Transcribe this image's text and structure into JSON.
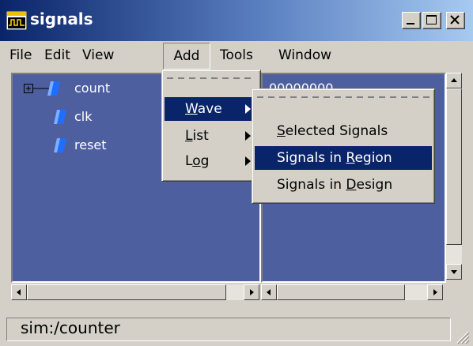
{
  "window": {
    "title": "signals",
    "icon": "wave-window-icon",
    "controls": [
      "minimize-icon",
      "maximize-icon",
      "close-icon"
    ]
  },
  "menubar": {
    "items": [
      {
        "label": "File"
      },
      {
        "label": "Edit"
      },
      {
        "label": "View"
      },
      {
        "label": "Add",
        "open": true
      },
      {
        "label": "Tools"
      },
      {
        "label": "Window"
      }
    ]
  },
  "signals": [
    {
      "name": "count",
      "expandable": true
    },
    {
      "name": "clk",
      "expandable": false
    },
    {
      "name": "reset",
      "expandable": false
    }
  ],
  "values": {
    "first_value": "00000000"
  },
  "add_menu": {
    "items": [
      {
        "pre": "",
        "u": "W",
        "post": "ave",
        "has_submenu": true,
        "highlighted": true
      },
      {
        "pre": "",
        "u": "L",
        "post": "ist",
        "has_submenu": true,
        "highlighted": false
      },
      {
        "pre": "L",
        "u": "o",
        "post": "g",
        "has_submenu": true,
        "highlighted": false
      }
    ]
  },
  "wave_submenu": {
    "items": [
      {
        "pre": "",
        "u": "S",
        "post": "elected Signals",
        "highlighted": false
      },
      {
        "pre": "Signals in ",
        "u": "R",
        "post": "egion",
        "highlighted": true
      },
      {
        "pre": "Signals in ",
        "u": "D",
        "post": "esign",
        "highlighted": false
      }
    ]
  },
  "statusbar": {
    "text": "sim:/counter"
  },
  "colors": {
    "title_gradient_start": "#0a246a",
    "title_gradient_end": "#a6caf0",
    "pane_background": "#4e5fa0",
    "highlight": "#0a246a",
    "face": "#d4d0c8",
    "signal_icon": "#1e6fff"
  }
}
